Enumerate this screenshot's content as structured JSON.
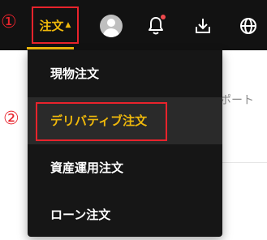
{
  "topbar": {
    "order_label": "注文",
    "order_caret": "▲",
    "icons": [
      "avatar-icon",
      "bell-icon",
      "download-icon",
      "globe-icon"
    ],
    "accent_color": "#f0b90b",
    "background_color": "#121212"
  },
  "annotations": {
    "step1": "①",
    "step2": "②",
    "color": "#e8232c"
  },
  "background_text": "ポート",
  "dropdown": {
    "items": [
      {
        "label": "現物注文"
      },
      {
        "label": "デリバティブ注文"
      },
      {
        "label": "資産運用注文"
      },
      {
        "label": "ローン注文"
      }
    ],
    "active_item": "デリバティブ注文"
  }
}
